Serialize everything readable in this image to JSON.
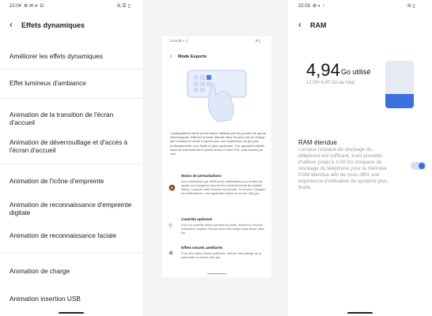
{
  "left": {
    "status_time": "22:04",
    "status_icons": "⚙ ✉ ⊳ G",
    "status_right": "ℝ ☰ ▯",
    "title": "Effets dynamiques",
    "items": [
      "Améliorer les effets dynamiques",
      "Effet lumineux d'ambiance",
      "Animation de la transition de l'écran d'accueil",
      "Animation de déverrouillage et d'accès à l'écran d'accueil",
      "Animation de l'icône d'empreinte",
      "Animation de reconnaissance d'empreinte digitale",
      "Animation de reconnaissance faciale",
      "Animation de charge",
      "Animation insertion USB"
    ]
  },
  "middle": {
    "status_time": "22:03",
    "status_icons": "⚙ ◐ ▢",
    "status_right": "ℝ ▯",
    "title": "Mode Esports",
    "description": "Configurations haute performance utilisées par les joueurs de sports électroniques. Affichez la barre latérale dans les jeux pris en charge afin d'activer le mode E-sports pour une expérience de jeu plus professionnelle, plus fluide et plus captivante. Ces appareils utilisés dans les événements E-sports Arena of Valor KPL sont fournis par vivo.",
    "features": [
      {
        "icon": "🔕",
        "title": "Moins de perturbations",
        "desc": "Les notifications par SMS et les notifications pour toutes les applis sont bloquées (hormis les avertissements de batterie faible). Lorsque cette fonction est activée, le bouton « Bloquer les notifications » est également activé en mode Ultra jeu."
      },
      {
        "icon": "⚲",
        "title": "Contrôle optimisé",
        "desc": "Pour un contrôle précis pendant la partie, activez la fonction Désactiver capteur d'écran avec trois doigts dans Mode Ultra jeu."
      },
      {
        "icon": "◉",
        "title": "Effets visuels améliorés",
        "desc": "Pour des effets visuels optimaux, activez Verrouillage de la luminosité en mode Ultra jeu."
      }
    ]
  },
  "right": {
    "status_time": "22:03",
    "status_icons": "⚙ ◐ ↑",
    "status_right": "ℝ ▯",
    "title": "RAM",
    "ram_value": "4,94",
    "ram_unit": "Go utilisé",
    "ram_total": "12,00+4,00 Go au total",
    "ram_fill_fraction": 0.3,
    "accent": "#3d6fe0",
    "extended_title": "RAM étendue",
    "extended_desc": "Lorsque l'espace de stockage du téléphone est suffisant, il est possible d'utiliser jusqu'à 4,00 Go d'espace de stockage du téléphone pour la mémoire RAM étendue afin de vous offrir une expérience d'utilisation du système plus fluide.",
    "extended_enabled": true
  }
}
